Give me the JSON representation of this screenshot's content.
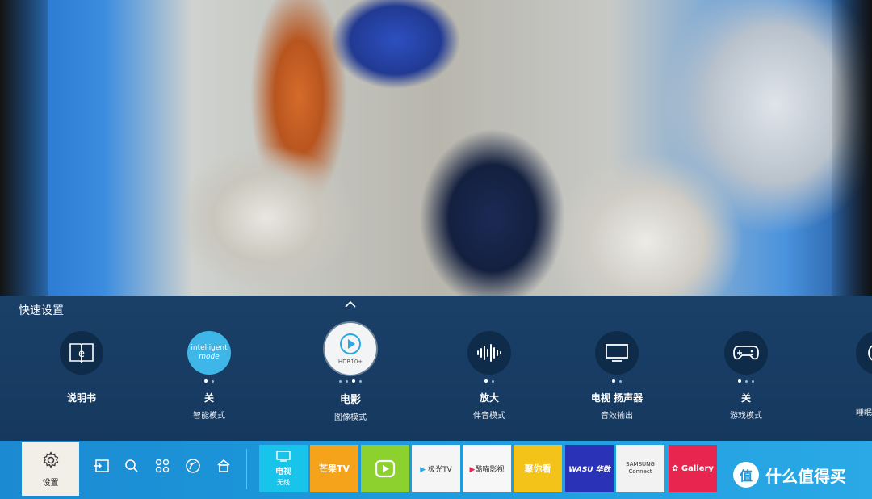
{
  "quick_settings": {
    "title": "快速设置",
    "items": [
      {
        "label": "说明书",
        "sub": "",
        "icon": "e-manual-book-icon"
      },
      {
        "label": "关",
        "sub": "智能模式",
        "icon": "intelligent-mode-icon",
        "badge_line1": "intelligent",
        "badge_line2": "mode"
      },
      {
        "label": "电影",
        "sub": "图像模式",
        "icon": "hdr10-play-icon",
        "badge": "HDR10+"
      },
      {
        "label": "放大",
        "sub": "伴音模式",
        "icon": "sound-wave-icon"
      },
      {
        "label": "电视 扬声器",
        "sub": "音效输出",
        "icon": "tv-speaker-icon"
      },
      {
        "label": "关",
        "sub": "游戏模式",
        "icon": "gamepad-icon"
      },
      {
        "label": "",
        "sub": "睡眠",
        "icon": "clock-icon"
      }
    ]
  },
  "bottom_bar": {
    "settings_label": "设置",
    "nav_icons": [
      "source-input-icon",
      "search-icon",
      "apps-grid-icon",
      "ambient-icon",
      "home-icon"
    ],
    "apps": [
      {
        "name": "电视",
        "sub": "无线",
        "color": "#19c4ea"
      },
      {
        "name": "芒果TV",
        "color": "#f4a31b"
      },
      {
        "name": "爱奇艺",
        "color": "#8dd12e"
      },
      {
        "name": "极光TV",
        "color": "#f5f5f5"
      },
      {
        "name": "酷喵影视",
        "color": "#f7f7f7"
      },
      {
        "name": "聚你看",
        "color": "#f4c31a"
      },
      {
        "name": "WASU 华数",
        "color": "#2a32b8"
      },
      {
        "name": "SAMSUNG Connect",
        "color": "#f2f2f2"
      },
      {
        "name": "Gallery",
        "color": "#e8254f"
      }
    ]
  },
  "watermark": {
    "logo": "值",
    "text": "什么值得买"
  },
  "colors": {
    "panel": "#1c446e",
    "bar": "#1d98db",
    "accent": "#19c4ea"
  }
}
